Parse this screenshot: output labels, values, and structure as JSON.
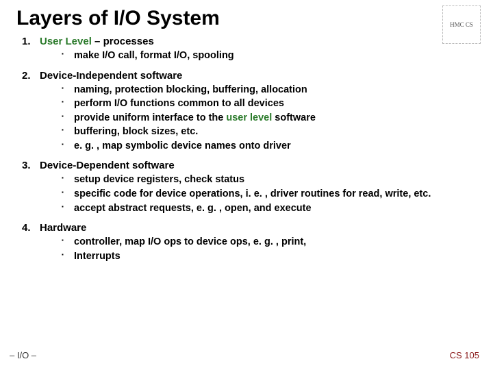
{
  "title": "Layers of I/O System",
  "logo_text": "HMC CS",
  "items": [
    {
      "num": "1.",
      "heading_pre": "User Level",
      "heading_post": " – processes",
      "heading_pre_green": true,
      "bullets": [
        {
          "text": "make I/O call, format I/O, spooling"
        }
      ]
    },
    {
      "num": "2.",
      "heading_pre": "Device-Independent",
      "heading_post": " software",
      "heading_pre_green": false,
      "bullets": [
        {
          "text": "naming, protection blocking, buffering, allocation"
        },
        {
          "text": "perform I/O functions common to all devices"
        },
        {
          "pre": "provide uniform interface to the ",
          "green": "user level",
          "post": " software"
        },
        {
          "text": "buffering, block sizes, etc."
        },
        {
          "text": "e. g. , map symbolic device names onto driver"
        }
      ]
    },
    {
      "num": "3.",
      "heading_pre": "Device-Dependent",
      "heading_post": " software",
      "heading_pre_green": false,
      "bullets": [
        {
          "text": "setup device registers, check status"
        },
        {
          "text": "specific code for device operations, i. e. , driver routines for  read, write, etc."
        },
        {
          "text": "accept abstract requests, e. g. , open, and execute"
        }
      ]
    },
    {
      "num": "4.",
      "heading_pre": "Hardware",
      "heading_post": "",
      "heading_pre_green": false,
      "bullets": [
        {
          "text": "controller, map I/O ops to device ops, e. g. , print,"
        },
        {
          "text": "Interrupts"
        }
      ]
    }
  ],
  "footer_left": "– I/O –",
  "footer_right": "CS 105"
}
